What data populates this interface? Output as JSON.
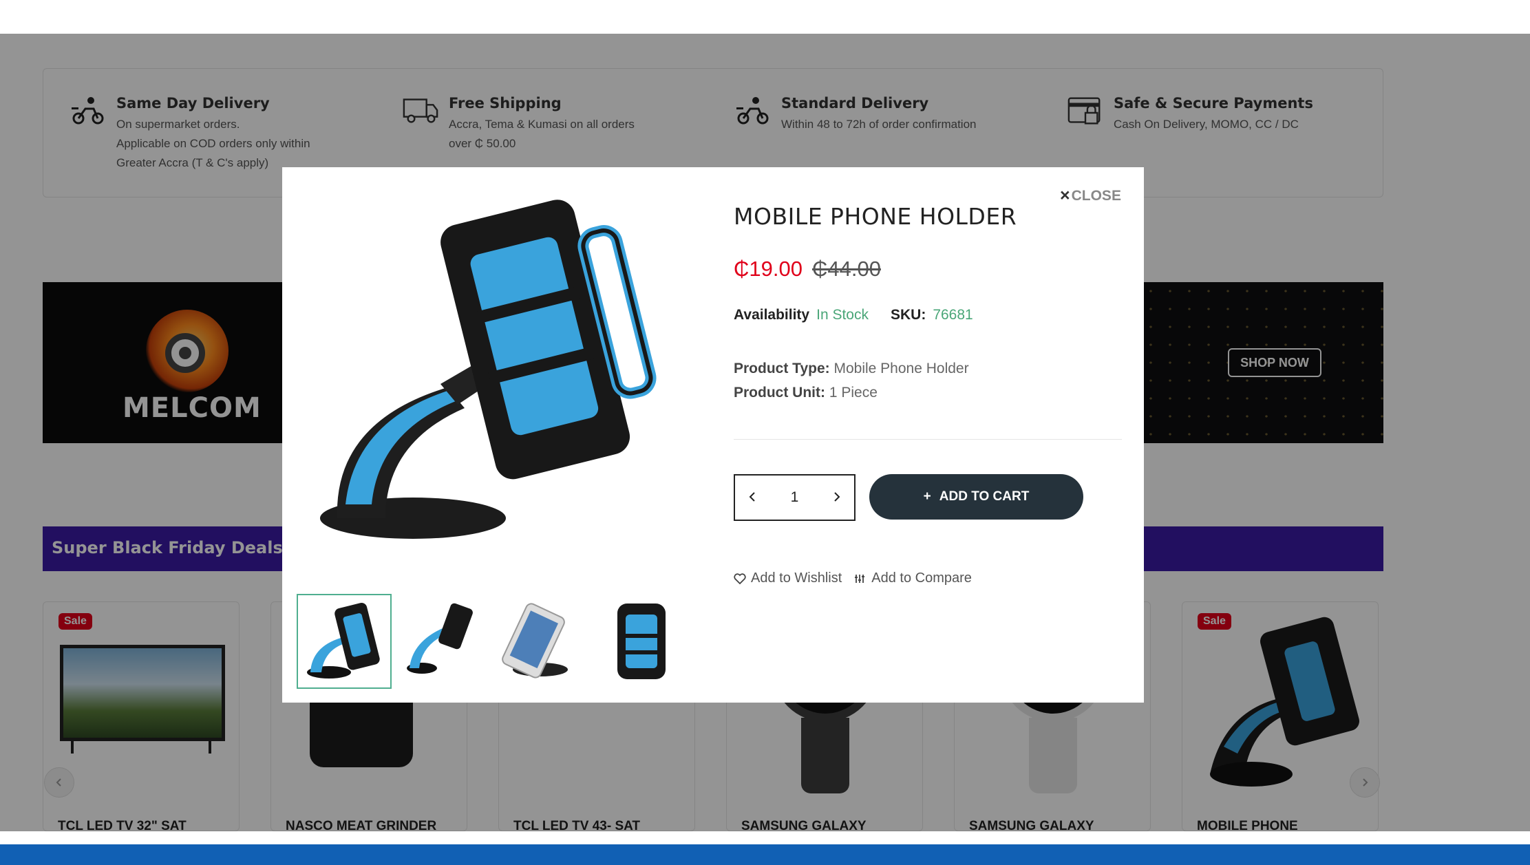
{
  "features": [
    {
      "title": "Same Day Delivery",
      "lines": [
        "On supermarket orders.",
        "Applicable on COD orders only within",
        "Greater Accra (T & C's apply)"
      ],
      "icon": "delivery-scooter-icon"
    },
    {
      "title": "Free Shipping",
      "lines": [
        "Accra, Tema & Kumasi on all orders",
        "over ₵ 50.00"
      ],
      "icon": "truck-icon"
    },
    {
      "title": "Standard Delivery",
      "lines": [
        "Within 48 to 72h of order confirmation"
      ],
      "icon": "delivery-scooter-icon"
    },
    {
      "title": "Safe & Secure Payments",
      "lines": [
        "Cash On Delivery, MOMO, CC / DC"
      ],
      "icon": "secure-payment-icon"
    }
  ],
  "banner": {
    "brand": "MELCOM",
    "cta": "SHOP NOW"
  },
  "deals": {
    "title": "Super Black Friday Deals"
  },
  "products": [
    {
      "title": "TCL LED TV 32\" SAT",
      "badge": "Sale"
    },
    {
      "title": "NASCO MEAT GRINDER",
      "badge": ""
    },
    {
      "title": "TCL LED TV 43- SAT",
      "badge": ""
    },
    {
      "title": "SAMSUNG GALAXY",
      "badge": ""
    },
    {
      "title": "SAMSUNG GALAXY",
      "badge": ""
    },
    {
      "title": "MOBILE PHONE",
      "badge": "Sale"
    }
  ],
  "modal": {
    "close_label": "CLOSE",
    "close_symbol": "×",
    "title": "MOBILE PHONE HOLDER",
    "price": "₵19.00",
    "old_price": "₵44.00",
    "availability_label": "Availability",
    "availability_value": "In Stock",
    "sku_label": "SKU:",
    "sku_value": "76681",
    "product_type_label": "Product Type:",
    "product_type_value": "Mobile Phone Holder",
    "product_unit_label": "Product Unit:",
    "product_unit_value": "1 Piece",
    "quantity": "1",
    "add_to_cart": "ADD TO CART",
    "add_to_cart_symbol": "+",
    "wishlist": "Add to Wishlist",
    "compare": "Add to Compare"
  },
  "colors": {
    "accent": "#25323b",
    "price": "#e0001a",
    "stock": "#4aa678",
    "deals_bar": "#3c1aa6",
    "footer": "#1160b4"
  }
}
